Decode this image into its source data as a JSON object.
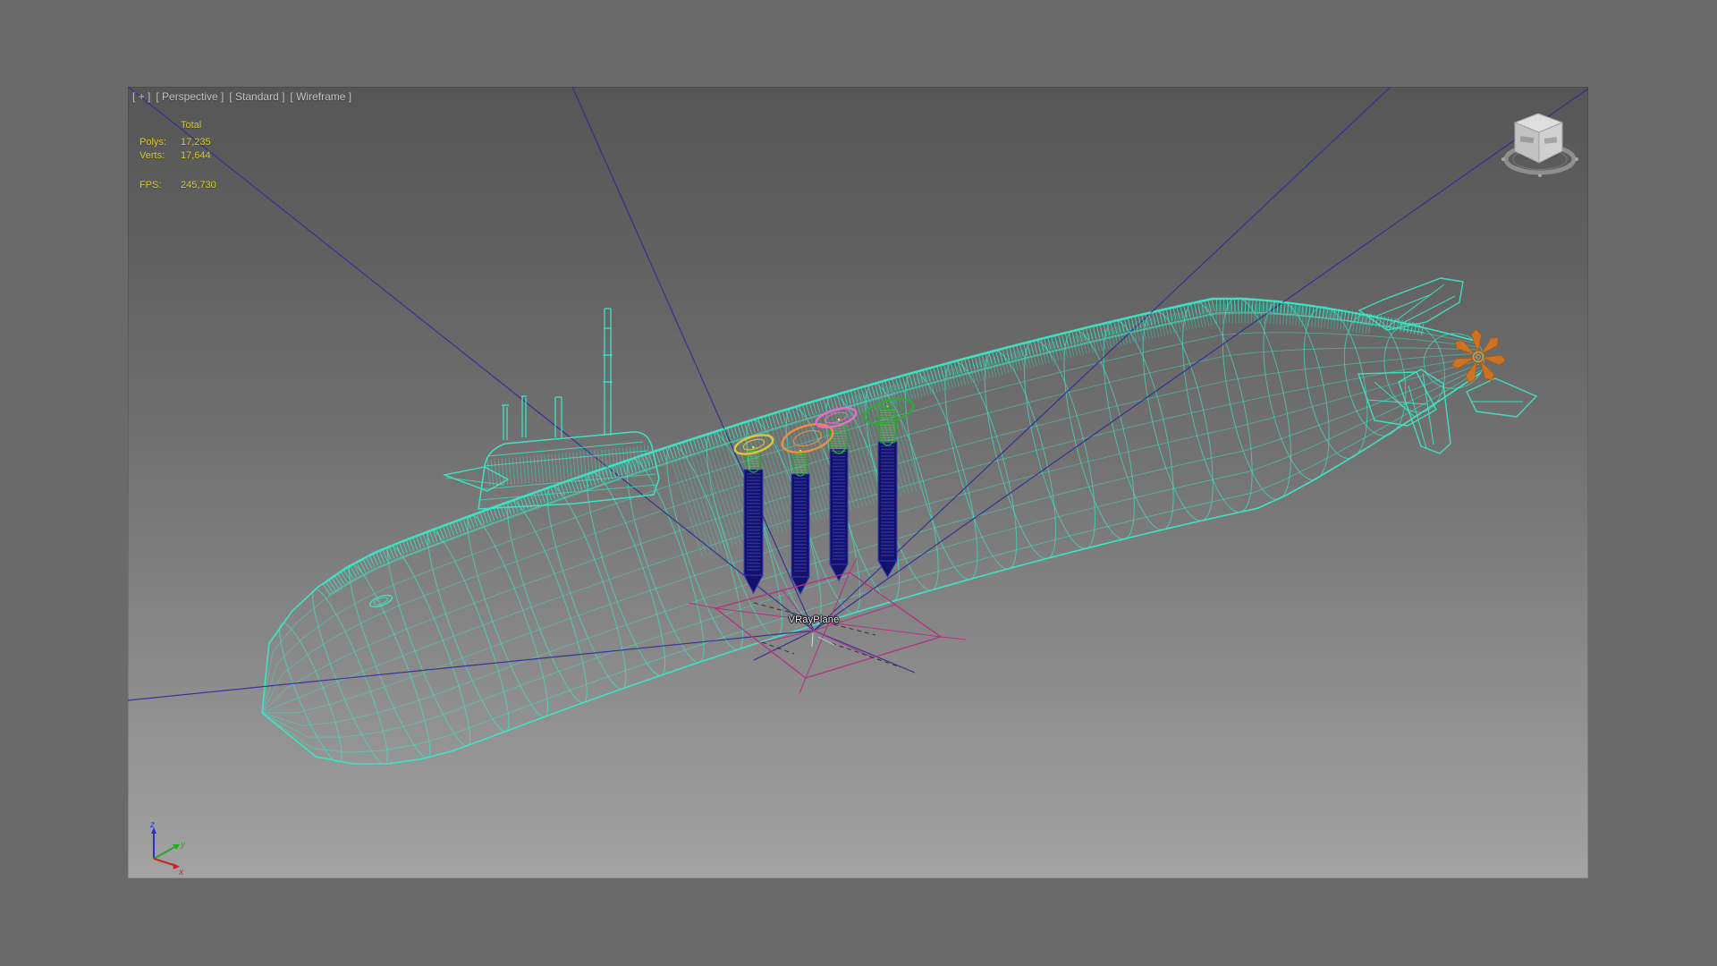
{
  "window": {
    "viewport_label": {
      "plus": "[ + ]",
      "view": "[ Perspective ]",
      "renderer": "[ Standard ]",
      "shading": "[ Wireframe ]"
    }
  },
  "statistics": {
    "total_header": "Total",
    "polys_label": "Polys:",
    "polys_value": "17,235",
    "verts_label": "Verts:",
    "verts_value": "17,644",
    "fps_label": "FPS:",
    "fps_value": "245,730"
  },
  "scene": {
    "plane_label": "VRayPlane"
  },
  "axis_tripod": {
    "x_label": "x",
    "y_label": "y",
    "z_label": "z"
  },
  "colors": {
    "wireframe": "#3fe3c3",
    "missile_body": "#12126b",
    "missile_edge": "#3a3ab8",
    "missile_hatch": "#4a4ac8",
    "cone_green": "#2f9e35",
    "cone_green_bright": "#54d44c",
    "ray_line": "#2e2e96",
    "plane_gizmo": "#b43084",
    "propeller": "#d4731c",
    "propeller_edge": "#a85810",
    "hub": "#caa24a",
    "hatch_yellow": "#e6c235",
    "hatch_orange": "#eb9140",
    "hatch_pink": "#f068ce",
    "hatch_green": "#34a834",
    "stats_text": "#d9cb2e",
    "viewport_label_text": "#c3c3c3",
    "axis_x": "#cc2222",
    "axis_y": "#22aa22",
    "axis_z": "#2233cc"
  }
}
